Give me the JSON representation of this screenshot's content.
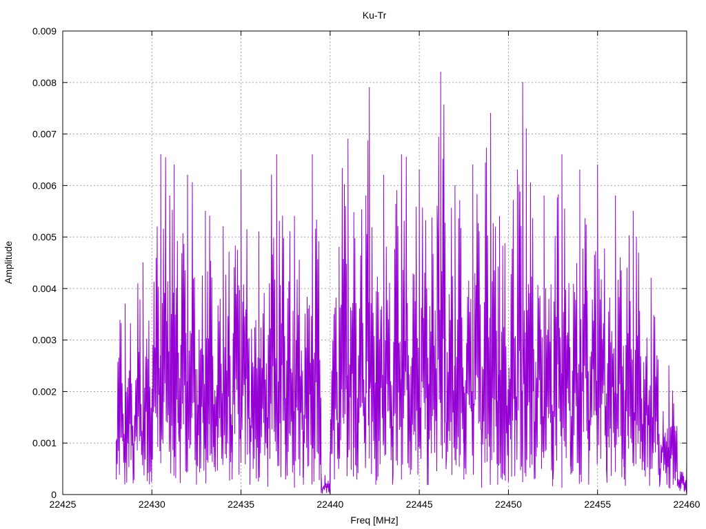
{
  "chart_data": {
    "type": "line",
    "title": "Ku-Tr",
    "xlabel": "Freq [MHz]",
    "ylabel": "Amplitude",
    "xlim": [
      22425,
      22460
    ],
    "ylim": [
      0,
      0.009
    ],
    "xticks": [
      22425,
      22430,
      22435,
      22440,
      22445,
      22450,
      22455,
      22460
    ],
    "yticks": [
      0,
      0.001,
      0.002,
      0.003,
      0.004,
      0.005,
      0.006,
      0.007,
      0.008,
      0.009
    ],
    "xtick_labels": [
      "22425",
      "22430",
      "22435",
      "22440",
      "22445",
      "22450",
      "22455",
      "22460"
    ],
    "ytick_labels": [
      "0",
      "0.001",
      "0.002",
      "0.003",
      "0.004",
      "0.005",
      "0.006",
      "0.007",
      "0.008",
      "0.009"
    ],
    "grid": true,
    "series": [
      {
        "color": "#9400d3",
        "x": [
          22428.0,
          22428.5,
          22429.0,
          22429.5,
          22430.0,
          22430.5,
          22431.0,
          22431.25,
          22431.5,
          22432.0,
          22432.5,
          22433.0,
          22433.5,
          22434.0,
          22434.5,
          22435.0,
          22435.5,
          22436.0,
          22436.5,
          22437.0,
          22437.5,
          22438.0,
          22438.5,
          22439.0,
          22439.5,
          22440.0,
          22440.5,
          22441.0,
          22441.5,
          22442.0,
          22442.2,
          22442.5,
          22443.0,
          22443.5,
          22444.0,
          22444.5,
          22445.0,
          22445.5,
          22446.0,
          22446.2,
          22446.5,
          22447.0,
          22447.5,
          22448.0,
          22448.5,
          22449.0,
          22449.4,
          22449.5,
          22450.0,
          22450.5,
          22450.8,
          22451.0,
          22451.5,
          22452.0,
          22452.5,
          22453.0,
          22453.5,
          22454.0,
          22454.5,
          22455.0,
          22455.5,
          22456.0,
          22456.5,
          22457.0,
          22457.5,
          22458.0,
          22458.5,
          22459.0,
          22459.5,
          22460.0
        ],
        "y": [
          0.0003,
          0.0037,
          0.0009,
          0.0045,
          0.0008,
          0.0066,
          0.0058,
          0.0064,
          0.0012,
          0.0062,
          0.0002,
          0.0055,
          0.0006,
          0.0052,
          0.0003,
          0.0063,
          0.0002,
          0.0051,
          0.0004,
          0.0066,
          0.0003,
          0.0054,
          0.0002,
          0.0066,
          0.0004,
          0.0001,
          0.0048,
          0.0069,
          0.0003,
          0.0058,
          0.0079,
          0.0008,
          0.0062,
          0.0002,
          0.0066,
          0.0004,
          0.0063,
          0.0003,
          0.0056,
          0.0082,
          0.0005,
          0.006,
          0.0003,
          0.0064,
          0.0006,
          0.0074,
          0.0002,
          0.0054,
          0.0003,
          0.0063,
          0.008,
          0.0071,
          0.0007,
          0.0058,
          0.0003,
          0.0066,
          0.0004,
          0.0063,
          0.0002,
          0.0064,
          0.0005,
          0.0058,
          0.0003,
          0.0055,
          0.0006,
          0.0042,
          0.0002,
          0.0025,
          0.0003,
          0.0006
        ]
      }
    ]
  }
}
